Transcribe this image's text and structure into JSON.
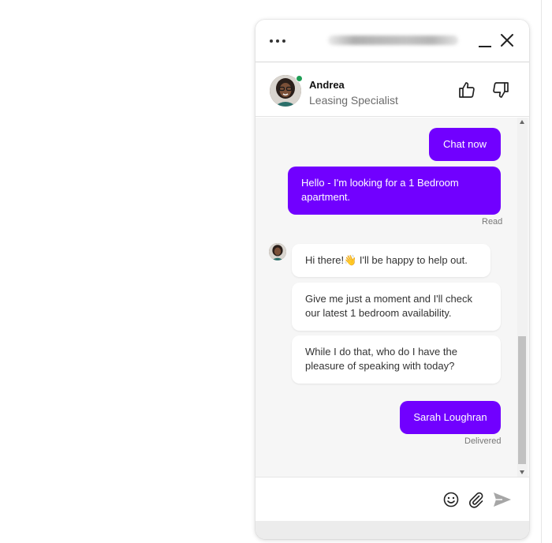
{
  "header": {
    "menu_icon": "more-horizontal-icon",
    "minimize_icon": "minimize-icon",
    "close_icon": "close-icon"
  },
  "agent": {
    "name": "Andrea",
    "role": "Leasing Specialist",
    "status": "online",
    "status_color": "#1f9d55"
  },
  "feedback": {
    "thumbs_up_icon": "thumbs-up-icon",
    "thumbs_down_icon": "thumbs-down-icon"
  },
  "messages": [
    {
      "from": "user",
      "text": "Chat now"
    },
    {
      "from": "user",
      "text": "Hello - I'm looking for a 1 Bedroom apartment.",
      "status": "Read"
    },
    {
      "from": "agent",
      "text": "Hi there!👋 I'll be happy to help out."
    },
    {
      "from": "agent",
      "text": "Give me just a moment and I'll check our latest 1 bedroom availability."
    },
    {
      "from": "agent",
      "text": "While I do that, who do I have the pleasure of speaking with today?"
    },
    {
      "from": "user",
      "text": "Sarah Loughran",
      "status": "Delivered"
    }
  ],
  "composer": {
    "placeholder": "",
    "emoji_icon": "emoji-icon",
    "attach_icon": "paperclip-icon",
    "send_icon": "send-icon"
  },
  "colors": {
    "accent": "#7100ff",
    "chat_background": "#f6f6f6",
    "agent_bubble": "#ffffff"
  }
}
